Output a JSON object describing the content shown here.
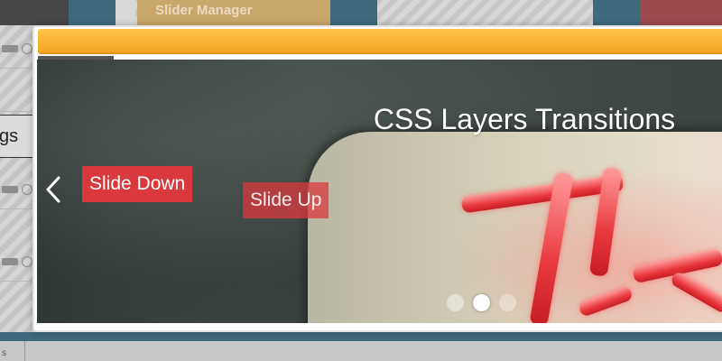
{
  "background": {
    "tab_label": "Slider Manager",
    "settings_fragment": "gs",
    "bottom_fragment": "s"
  },
  "slider": {
    "title": "CSS Layers Transitions",
    "layers": [
      {
        "label": "Slide Down"
      },
      {
        "label": "Slide Up"
      }
    ],
    "bullets": {
      "count": 3,
      "active_index": 1
    },
    "prev_arrow_icon": "chevron-left-icon"
  },
  "colors": {
    "header_orange": "#f5a623",
    "layer_red": "#d9393c",
    "teal_accent": "#3e6a7c"
  }
}
